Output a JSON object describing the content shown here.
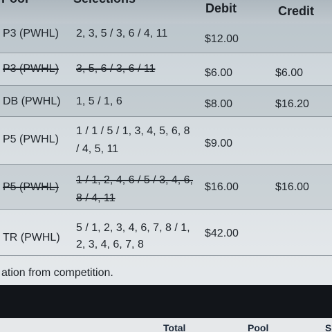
{
  "table": {
    "headers": {
      "pool": "Pool",
      "selections": "Selections",
      "debit": "Debit",
      "credit": "Credit"
    },
    "rows": [
      {
        "pool": "P3 (PWHL)",
        "selections": "2, 3, 5 / 3, 6 / 4, 11",
        "debit": "$12.00",
        "credit": "",
        "cancelled": false
      },
      {
        "pool": "P3 (PWHL)",
        "selections": "3, 5, 6 / 3, 6 / 11",
        "debit": "$6.00",
        "credit": "$6.00",
        "cancelled": true
      },
      {
        "pool": "DB (PWHL)",
        "selections": "1, 5 / 1, 6",
        "debit": "$8.00",
        "credit": "$16.20",
        "cancelled": false
      },
      {
        "pool": "P5 (PWHL)",
        "selections_line1": "1 / 1 / 5 / 1, 3, 4, 5, 6, 8",
        "selections_line2": "/ 4, 5, 11",
        "debit": "$9.00",
        "credit": "",
        "cancelled": false
      },
      {
        "pool": "P5 (PWHL)",
        "selections_line1": "1 / 1, 2, 4, 6 / 5 / 3, 4, 6,",
        "selections_line2": "8 / 4, 11",
        "debit": "$16.00",
        "credit": "$16.00",
        "cancelled": true
      },
      {
        "pool": "TR (PWHL)",
        "selections_line1": "5 / 1, 2, 3, 4, 6, 7, 8 / 1,",
        "selections_line2": "2, 3, 4, 6, 7, 8",
        "debit": "$42.00",
        "credit": "",
        "cancelled": false
      }
    ]
  },
  "footer_note": "ation from competition.",
  "bottom_tabs": {
    "total": "Total",
    "pool": "Pool",
    "s": "S"
  }
}
